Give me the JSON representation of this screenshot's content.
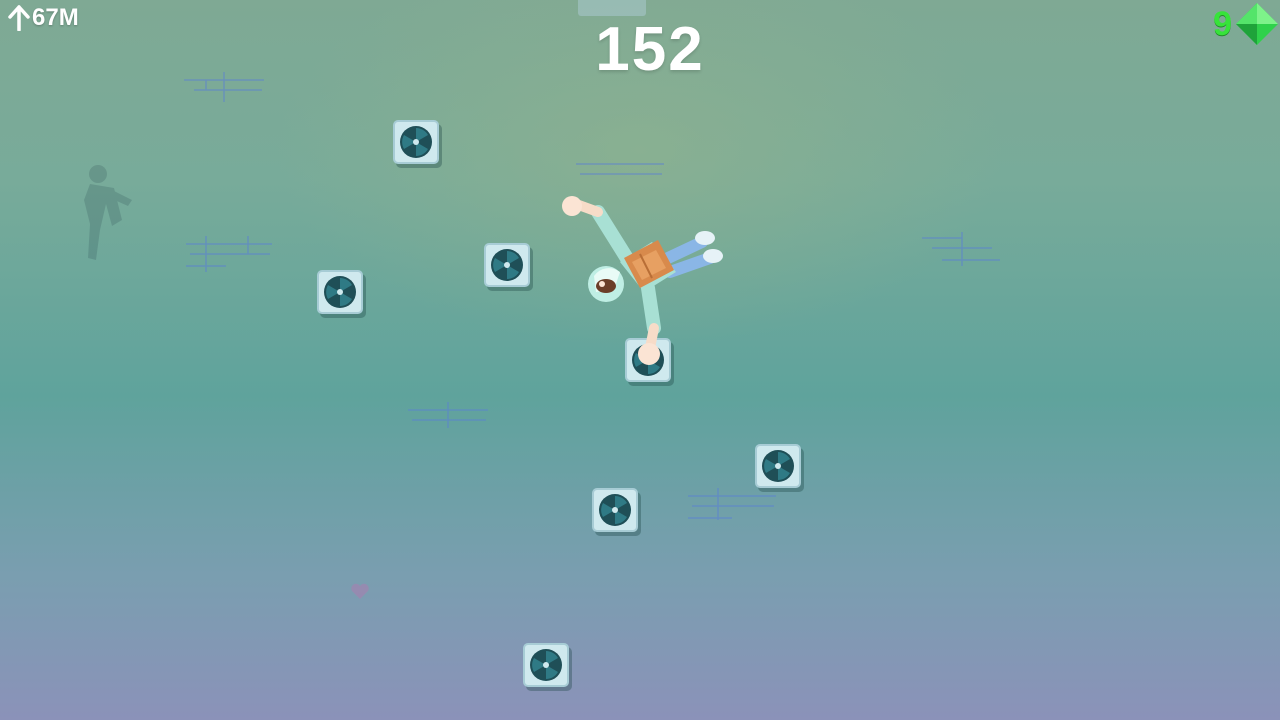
{
  "hud": {
    "height_label": "67M",
    "score": "152",
    "gem_count": "9"
  },
  "colors": {
    "gem": "#37e33a",
    "hold_face": "#cfe9ee",
    "hold_fan": "#1f4f57",
    "crack": "#5a7fd6"
  },
  "icons": {
    "height": "up-arrow-icon",
    "gem": "green-diamond-icon",
    "hold": "fan-hold-icon"
  }
}
